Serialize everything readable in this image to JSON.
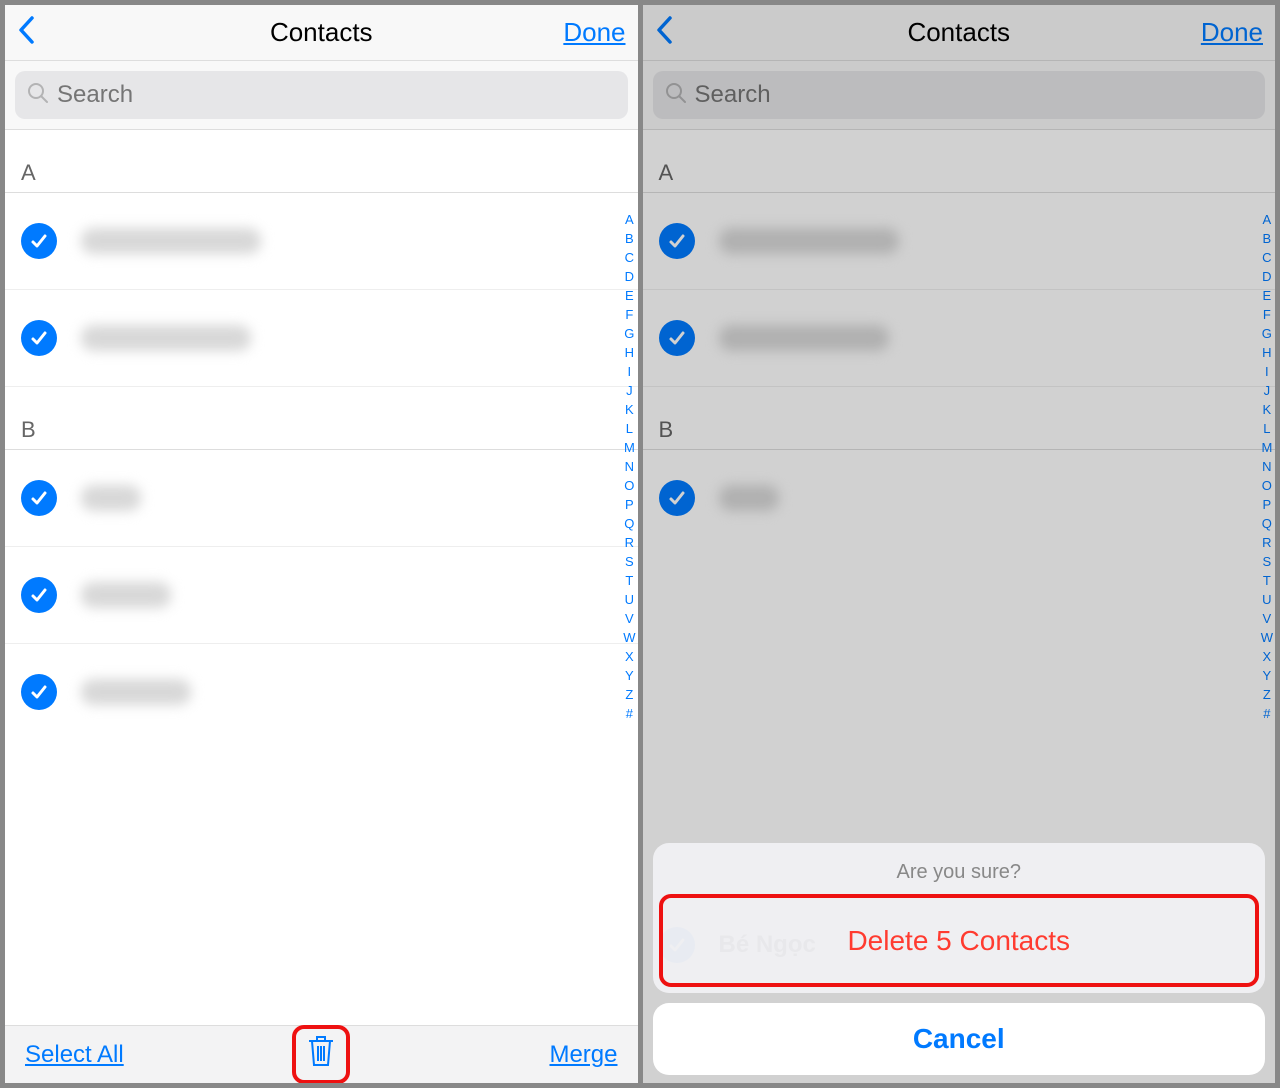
{
  "nav": {
    "title": "Contacts",
    "done": "Done"
  },
  "search": {
    "placeholder": "Search"
  },
  "sections": [
    {
      "letter": "A",
      "rows": [
        {
          "blurWidth": 180
        },
        {
          "blurWidth": 170
        }
      ]
    },
    {
      "letter": "B",
      "rows": [
        {
          "blurWidth": 60
        },
        {
          "blurWidth": 90
        },
        {
          "blurWidth": 110
        }
      ]
    }
  ],
  "sectionsRight": [
    {
      "letter": "A",
      "rows": [
        {
          "blurWidth": 180
        },
        {
          "blurWidth": 170
        }
      ]
    },
    {
      "letter": "B",
      "rows": [
        {
          "blurWidth": 60
        }
      ]
    }
  ],
  "alphaIndex": [
    "A",
    "B",
    "C",
    "D",
    "E",
    "F",
    "G",
    "H",
    "I",
    "J",
    "K",
    "L",
    "M",
    "N",
    "O",
    "P",
    "Q",
    "R",
    "S",
    "T",
    "U",
    "V",
    "W",
    "X",
    "Y",
    "Z",
    "#"
  ],
  "bottom": {
    "selectAll": "Select All",
    "merge": "Merge"
  },
  "peekName": "Bé Ngọc",
  "sheet": {
    "title": "Are you sure?",
    "delete": "Delete 5 Contacts",
    "cancel": "Cancel"
  }
}
